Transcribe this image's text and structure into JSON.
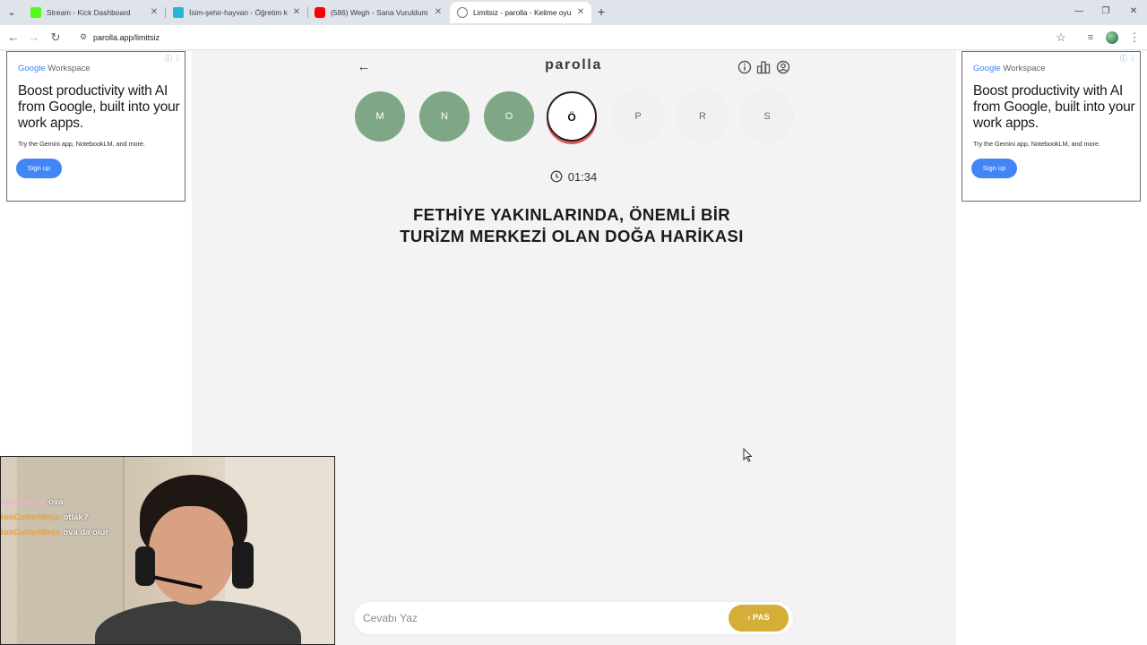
{
  "browser": {
    "tabs": [
      {
        "label": "Stream - Kick Dashboard",
        "favicon_color": "#53fc18",
        "active": false
      },
      {
        "label": "İsim-şehir-hayvan - Öğretim ka",
        "favicon_color": "#26b5d6",
        "active": false
      },
      {
        "label": "(586) Wegh - Sana Vuruldum /",
        "favicon_color": "#ff0000",
        "active": false
      },
      {
        "label": "Limitsiz - parolla - Kelime oyun",
        "favicon_color": "#ffffff",
        "active": true
      }
    ],
    "url": "parolla.app/limitsiz"
  },
  "ads": {
    "brand_google": "Google",
    "brand_workspace": "Workspace",
    "headline": "Boost productivity with AI from Google, built into your work apps.",
    "subtext": "Try the Gemini app, NotebookLM, and more.",
    "cta": "Sign up"
  },
  "game": {
    "logo": "parolla",
    "letters": [
      {
        "char": "M",
        "state": "done"
      },
      {
        "char": "N",
        "state": "done"
      },
      {
        "char": "O",
        "state": "done"
      },
      {
        "char": "Ö",
        "state": "current"
      },
      {
        "char": "P",
        "state": "pending"
      },
      {
        "char": "R",
        "state": "pending"
      },
      {
        "char": "S",
        "state": "pending"
      }
    ],
    "timer": "01:34",
    "question": "FETHİYE YAKINLARINDA, ÖNEMLİ BİR TURİZM MERKEZİ OLAN DOĞA HARİKASI",
    "answer_placeholder": "Cevabı Yaz",
    "answer_value": "",
    "pass_label": "PAS"
  },
  "colors": {
    "done": "#7fa785",
    "current_accent": "#e35656",
    "pass": "#d4ae37",
    "ad_cta": "#4285f4"
  },
  "webcam": {
    "chat": [
      {
        "user": "apshkciKA",
        "message": "ova"
      },
      {
        "user": "ionCutterNinja",
        "message": "otlak?"
      },
      {
        "user": "ionCutterNinja",
        "message": "ova da olur"
      }
    ]
  }
}
